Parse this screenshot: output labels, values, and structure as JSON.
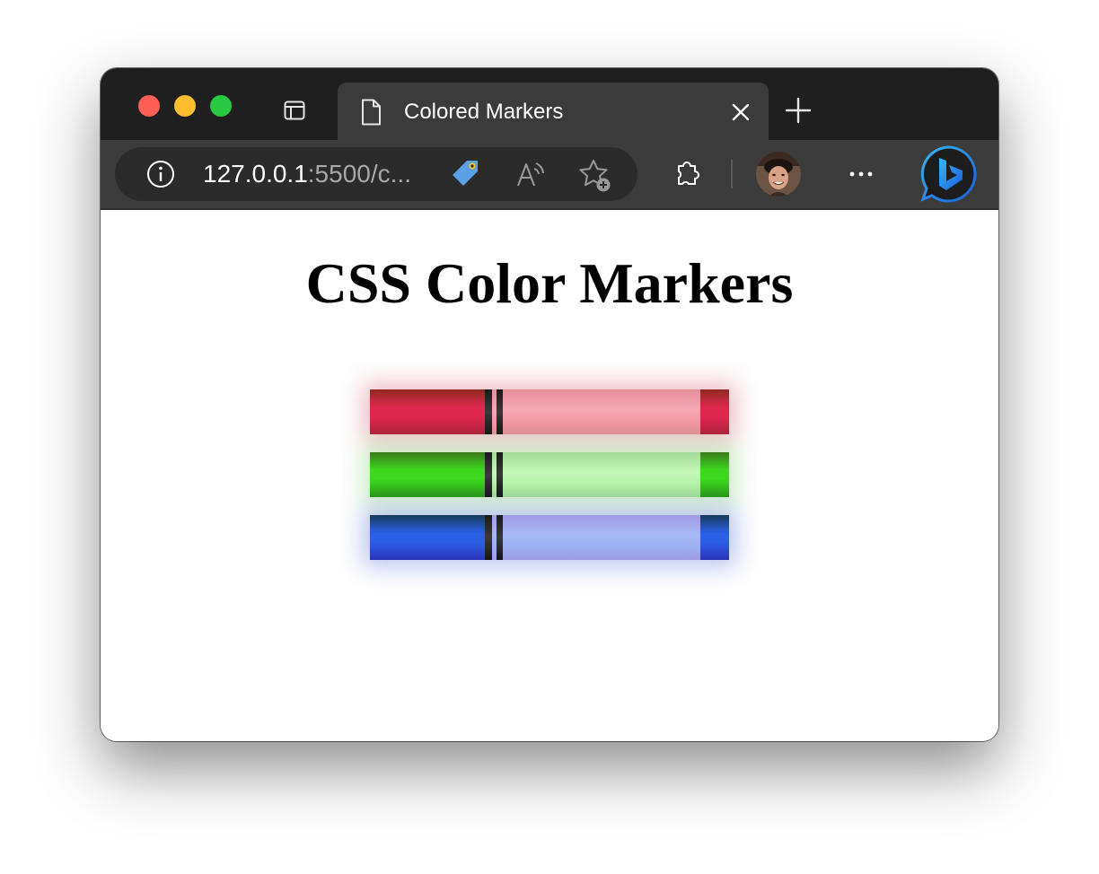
{
  "browser": {
    "tab": {
      "title": "Colored Markers"
    },
    "address": {
      "host": "127.0.0.1",
      "path": ":5500/c..."
    }
  },
  "page": {
    "heading": "CSS Color Markers",
    "markers": [
      {
        "name": "red",
        "body_dark": "#8e2a1e",
        "body_mid": "#e0284f",
        "body_deep": "#b21e3c",
        "cap_light": "#f5a8b4",
        "cap_mid": "#f19aa6",
        "cap_dark": "#e48e9a"
      },
      {
        "name": "green",
        "body_dark": "#3a7a1c",
        "body_mid": "#3ed81e",
        "body_deep": "#2a9a16",
        "cap_light": "#c4f8b8",
        "cap_mid": "#b5f3a8",
        "cap_dark": "#a2dc96"
      },
      {
        "name": "blue",
        "body_dark": "#163c5a",
        "body_mid": "#2a5fe6",
        "body_deep": "#2a34b8",
        "cap_light": "#a9b8f4",
        "cap_mid": "#9db0f2",
        "cap_dark": "#a09ce4"
      }
    ]
  }
}
